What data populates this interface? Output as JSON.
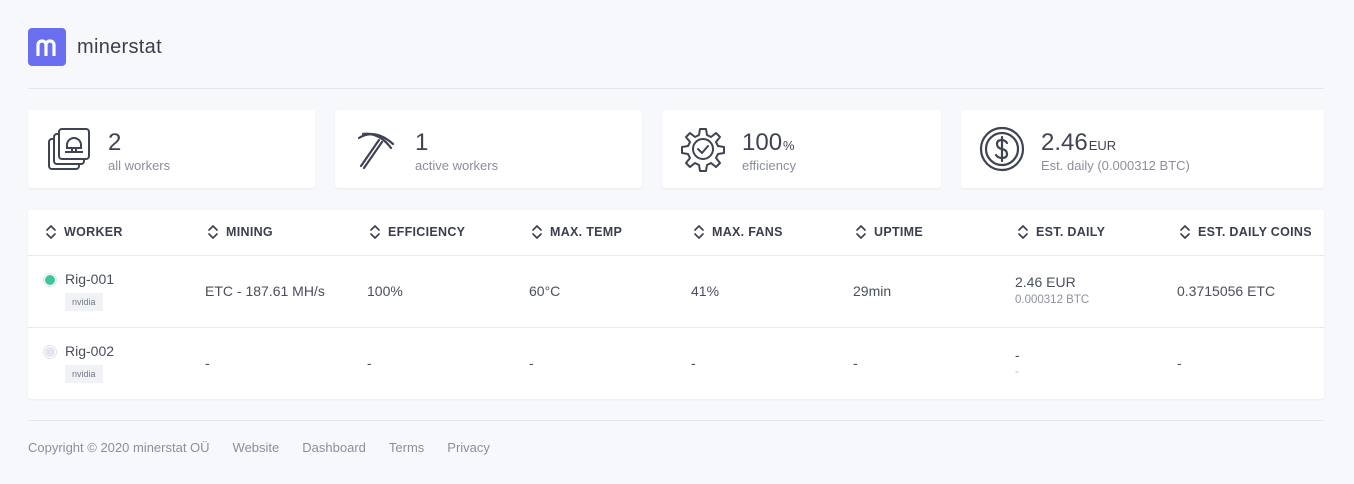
{
  "brand": {
    "name": "minerstat",
    "logo_letter": "m",
    "color": "#6a6ff0"
  },
  "stats": [
    {
      "icon": "rigs-stack-icon",
      "value": "2",
      "unit": "",
      "label": "all workers"
    },
    {
      "icon": "pickaxe-icon",
      "value": "1",
      "unit": "",
      "label": "active workers"
    },
    {
      "icon": "gear-check-icon",
      "value": "100",
      "unit": "%",
      "label": "efficiency"
    },
    {
      "icon": "dollar-coin-icon",
      "value": "2.46",
      "unit": "EUR",
      "label": "Est. daily (0.000312 BTC)"
    }
  ],
  "table": {
    "columns": [
      "WORKER",
      "MINING",
      "EFFICIENCY",
      "MAX. TEMP",
      "MAX. FANS",
      "UPTIME",
      "EST. DAILY",
      "EST. DAILY COINS"
    ],
    "rows": [
      {
        "status": "online",
        "status_color": "#3ec69a",
        "name": "Rig-001",
        "tag": "nvidia",
        "mining": "ETC - 187.61 MH/s",
        "efficiency": "100%",
        "max_temp": "60°C",
        "max_fans": "41%",
        "uptime": "29min",
        "est_daily": "2.46 EUR",
        "est_daily_btc": "0.000312 BTC",
        "est_daily_coins": "0.3715056 ETC"
      },
      {
        "status": "offline",
        "status_color": "#e6e4f3",
        "name": "Rig-002",
        "tag": "nvidia",
        "mining": "-",
        "efficiency": "-",
        "max_temp": "-",
        "max_fans": "-",
        "uptime": "-",
        "est_daily": "-",
        "est_daily_btc": "-",
        "est_daily_coins": "-"
      }
    ]
  },
  "footer": {
    "copyright": "Copyright © 2020 minerstat OÜ",
    "links": [
      "Website",
      "Dashboard",
      "Terms",
      "Privacy"
    ]
  }
}
